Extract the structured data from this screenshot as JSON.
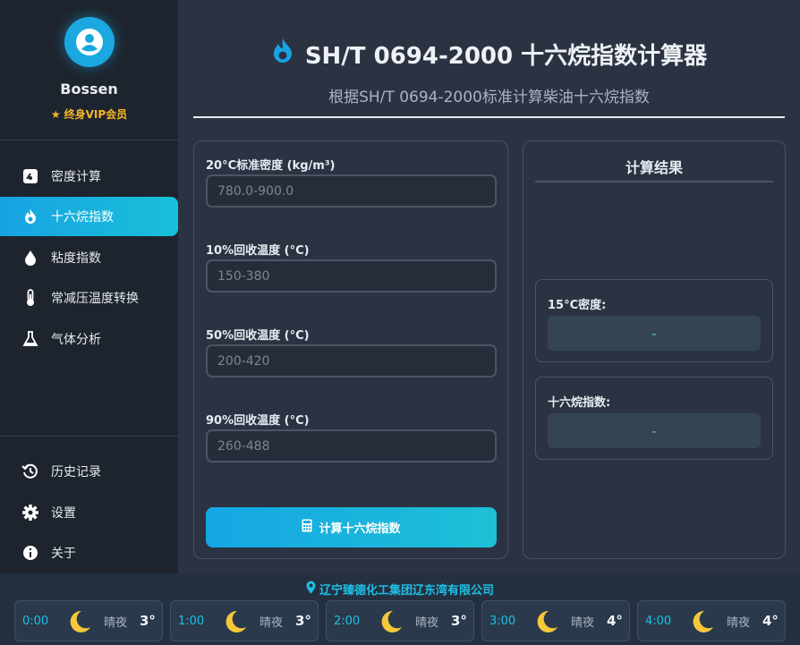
{
  "user": {
    "name": "Bossen",
    "badge": "终身VIP会员"
  },
  "nav": {
    "items": [
      {
        "label": "密度计算"
      },
      {
        "label": "十六烷指数"
      },
      {
        "label": "粘度指数"
      },
      {
        "label": "常减压温度转换"
      },
      {
        "label": "气体分析"
      }
    ],
    "bottom": [
      {
        "label": "历史记录"
      },
      {
        "label": "设置"
      },
      {
        "label": "关于"
      }
    ]
  },
  "header": {
    "title": "SH/T 0694-2000 十六烷指数计算器",
    "subtitle": "根据SH/T 0694-2000标准计算柴油十六烷指数"
  },
  "form": {
    "fields": [
      {
        "label": "20°C标准密度 (kg/m³)",
        "placeholder": "780.0-900.0",
        "value": ""
      },
      {
        "label": "10%回收温度 (°C)",
        "placeholder": "150-380",
        "value": ""
      },
      {
        "label": "50%回收温度 (°C)",
        "placeholder": "200-420",
        "value": ""
      },
      {
        "label": "90%回收温度 (°C)",
        "placeholder": "260-488",
        "value": ""
      }
    ],
    "button": "计算十六烷指数"
  },
  "results": {
    "title": "计算结果",
    "items": [
      {
        "label": "15°C密度:",
        "value": "-"
      },
      {
        "label": "十六烷指数:",
        "value": "-"
      }
    ]
  },
  "footer": {
    "company": "辽宁臻德化工集团辽东湾有限公司",
    "forecast": [
      {
        "time": "0:00",
        "condition": "晴夜",
        "temp": "3°",
        "icon": "crescent-moon-icon"
      },
      {
        "time": "1:00",
        "condition": "晴夜",
        "temp": "3°",
        "icon": "crescent-moon-icon"
      },
      {
        "time": "2:00",
        "condition": "晴夜",
        "temp": "3°",
        "icon": "crescent-moon-icon"
      },
      {
        "time": "3:00",
        "condition": "晴夜",
        "temp": "4°",
        "icon": "crescent-moon-icon"
      },
      {
        "time": "4:00",
        "condition": "晴夜",
        "temp": "4°",
        "icon": "crescent-moon-icon"
      }
    ]
  },
  "colors": {
    "accent": "#17a3e3",
    "vip": "#f5b72a",
    "result": "#4fd08a"
  }
}
